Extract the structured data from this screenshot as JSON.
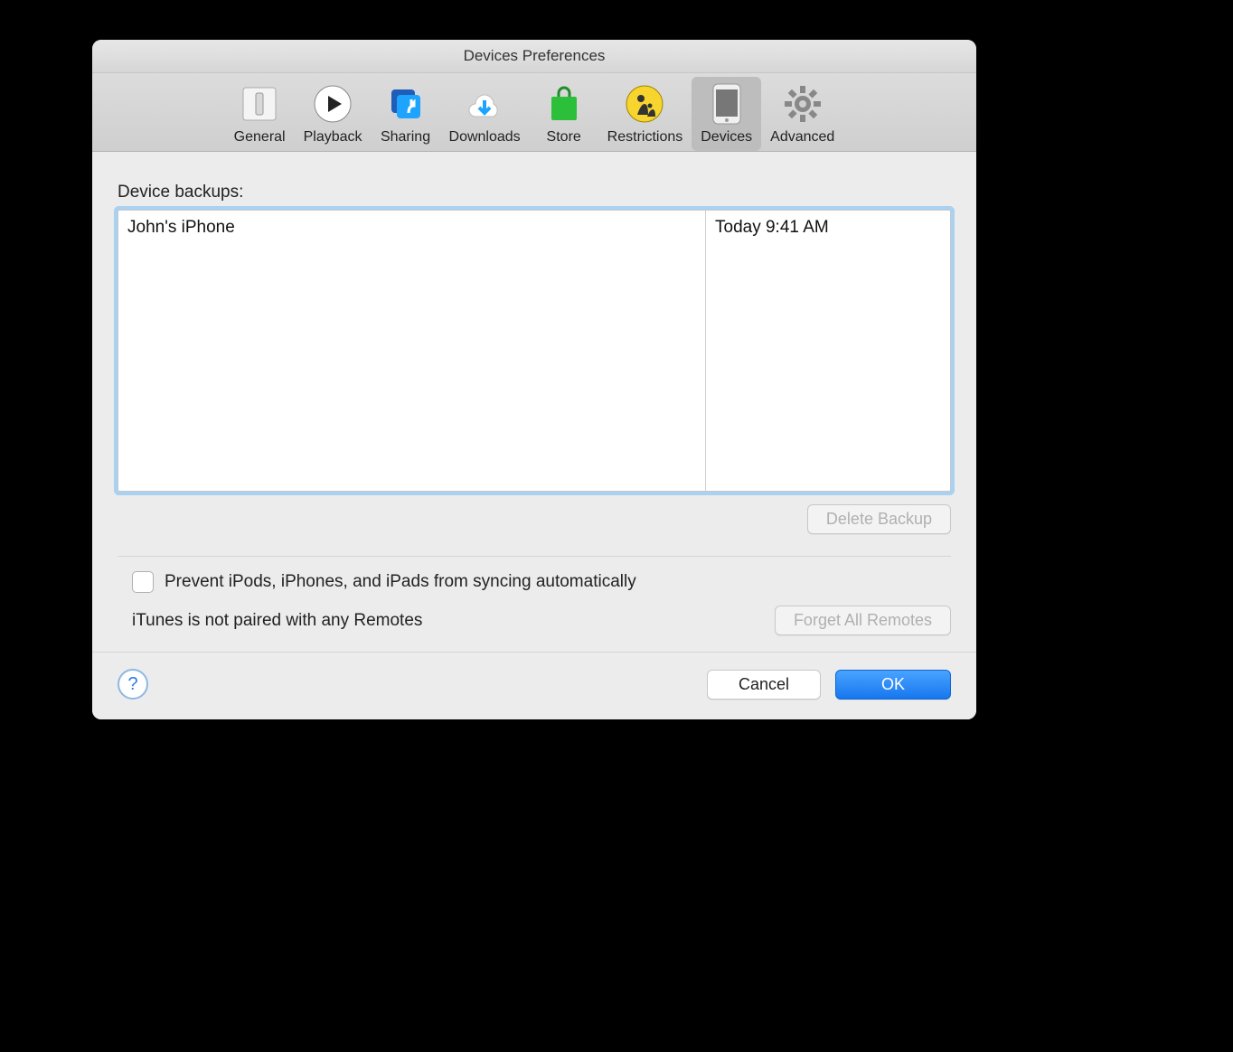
{
  "window": {
    "title": "Devices Preferences"
  },
  "toolbar": {
    "items": [
      {
        "label": "General"
      },
      {
        "label": "Playback"
      },
      {
        "label": "Sharing"
      },
      {
        "label": "Downloads"
      },
      {
        "label": "Store"
      },
      {
        "label": "Restrictions"
      },
      {
        "label": "Devices"
      },
      {
        "label": "Advanced"
      }
    ],
    "active_index": 6
  },
  "main": {
    "backups_label": "Device backups:",
    "backups": [
      {
        "name": "John's iPhone",
        "date": "Today 9:41 AM"
      }
    ],
    "delete_button": "Delete Backup",
    "prevent_sync_label": "Prevent iPods, iPhones, and iPads from syncing automatically",
    "prevent_sync_checked": false,
    "remotes_status": "iTunes is not paired with any Remotes",
    "forget_remotes_button": "Forget All Remotes"
  },
  "footer": {
    "help_tooltip": "?",
    "cancel": "Cancel",
    "ok": "OK"
  }
}
